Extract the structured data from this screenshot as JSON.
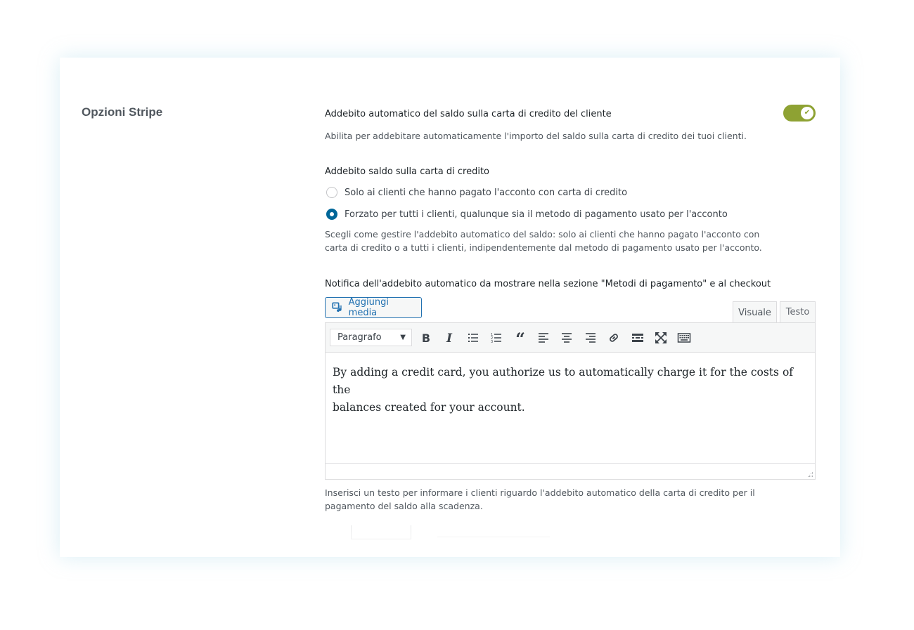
{
  "section": {
    "title": "Opzioni Stripe"
  },
  "auto_charge": {
    "label": "Addebito automatico del saldo sulla carta di credito del cliente",
    "description": "Abilita per addebitare automaticamente l'importo del saldo sulla carta di credito dei tuoi clienti.",
    "enabled": true,
    "toggle_color": "#8ea233"
  },
  "charge_mode": {
    "label": "Addebito saldo sulla carta di credito",
    "options": [
      {
        "label": "Solo ai clienti che hanno pagato l'acconto con carta di credito",
        "checked": false
      },
      {
        "label": "Forzato per tutti i clienti, qualunque sia il metodo di pagamento usato per l'acconto",
        "checked": true
      }
    ],
    "description_line1": "Scegli come gestire l'addebito automatico del saldo: solo ai clienti che hanno pagato l'acconto con",
    "description_line2": "carta di credito o a tutti i clienti, indipendentemente dal metodo di pagamento usato per l'acconto.",
    "radio_accent": "#006799"
  },
  "notice": {
    "label": "Notifica dell'addebito automatico da mostrare nella sezione \"Metodi di pagamento\" e al checkout",
    "add_media_label": "Aggiungi media",
    "tabs": [
      {
        "label": "Visuale",
        "active": true
      },
      {
        "label": "Testo",
        "active": false
      }
    ],
    "format_select": "Paragrafo",
    "toolbar_icons": [
      "bold-icon",
      "italic-icon",
      "bullet-list-icon",
      "numbered-list-icon",
      "blockquote-icon",
      "align-left-icon",
      "align-center-icon",
      "align-right-icon",
      "link-icon",
      "read-more-icon",
      "fullscreen-icon",
      "toolbar-toggle-icon"
    ],
    "content_line1": "By adding a credit card, you authorize us to automatically charge it for the costs of the",
    "content_line2": "balances created for your account.",
    "help_line1": "Inserisci un testo per informare i clienti riguardo l'addebito automatico della carta di credito per il",
    "help_line2": "pagamento del saldo alla scadenza.",
    "link_color": "#2271b1"
  }
}
